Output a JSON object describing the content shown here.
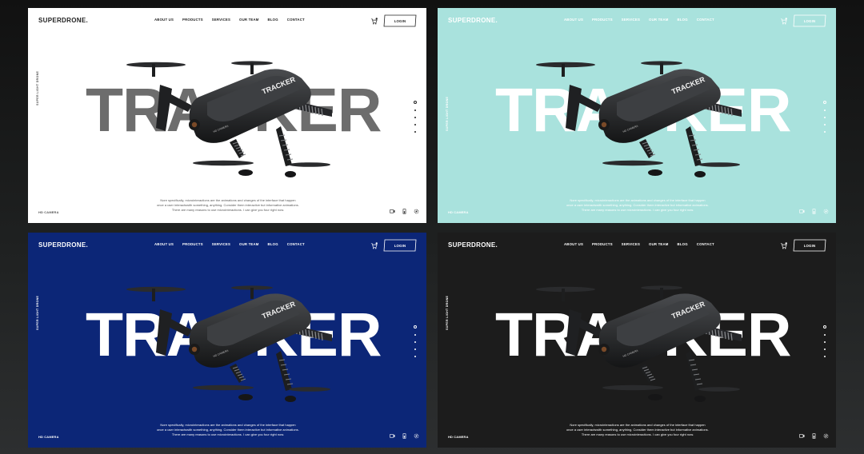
{
  "brand": "SUPERDRONE.",
  "nav": [
    "ABOUT US",
    "PRODUCTS",
    "SERVICES",
    "OUR TEAM",
    "BLOG",
    "CONTACT"
  ],
  "login_label": "LOGIN",
  "side_label": "SUPER LIGHT DRONE",
  "hero_word": "TRACKER",
  "drone_label": "TRACKER",
  "drone_small_label": "HD CAMERA",
  "description": [
    "Nore specifically, microinteractions are the animations and changes of the interface that happen",
    "once a user interactswith something, anything. Consider them interactive but informative animations.",
    "There are many reasons to use microinteractions. I can give you four right now."
  ],
  "hd_label": "HD CAMERA",
  "icons": [
    "cart-icon",
    "video-icon",
    "battery-icon",
    "settings-icon"
  ],
  "slider": {
    "count": 5,
    "active": 1
  },
  "themes": [
    {
      "bg": "#ffffff",
      "fg": "#222222",
      "hero": "#6d6d6d",
      "muted": "#555555"
    },
    {
      "bg": "#a9e2dd",
      "fg": "#ffffff",
      "hero": "#ffffff",
      "muted": "#ffffff"
    },
    {
      "bg": "#0c2677",
      "fg": "#ffffff",
      "hero": "#ffffff",
      "muted": "#ffffff"
    },
    {
      "bg": "#1c1c1c",
      "fg": "#ffffff",
      "hero": "#ffffff",
      "muted": "#ffffff"
    }
  ]
}
